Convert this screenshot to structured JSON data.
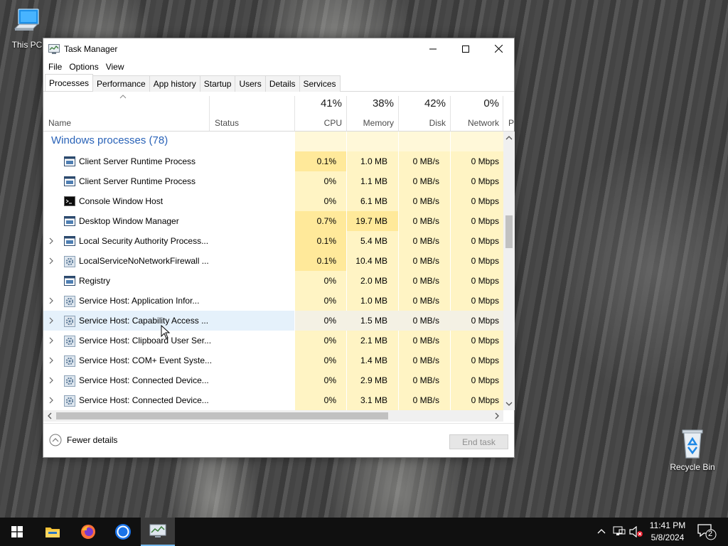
{
  "desktop": {
    "icons": [
      {
        "label": "This PC"
      },
      {
        "label": "Recycle Bin"
      }
    ]
  },
  "window": {
    "title": "Task Manager",
    "menu": [
      "File",
      "Options",
      "View"
    ],
    "tabs": [
      "Processes",
      "Performance",
      "App history",
      "Startup",
      "Users",
      "Details",
      "Services"
    ],
    "active_tab": "Processes",
    "columns": {
      "name": "Name",
      "status": "Status",
      "cpu": {
        "pct": "41%",
        "label": "CPU"
      },
      "memory": {
        "pct": "38%",
        "label": "Memory"
      },
      "disk": {
        "pct": "42%",
        "label": "Disk"
      },
      "network": {
        "pct": "0%",
        "label": "Network"
      },
      "power_partial": "P"
    },
    "group": {
      "title": "Windows processes (78)"
    },
    "processes": [
      {
        "name": "Client Server Runtime Process",
        "cpu": "0.1%",
        "memory": "1.0 MB",
        "disk": "0 MB/s",
        "network": "0 Mbps",
        "expandable": false,
        "icon": "window-icon"
      },
      {
        "name": "Client Server Runtime Process",
        "cpu": "0%",
        "memory": "1.1 MB",
        "disk": "0 MB/s",
        "network": "0 Mbps",
        "expandable": false,
        "icon": "window-icon"
      },
      {
        "name": "Console Window Host",
        "cpu": "0%",
        "memory": "6.1 MB",
        "disk": "0 MB/s",
        "network": "0 Mbps",
        "expandable": false,
        "icon": "console-icon"
      },
      {
        "name": "Desktop Window Manager",
        "cpu": "0.7%",
        "memory": "19.7 MB",
        "disk": "0 MB/s",
        "network": "0 Mbps",
        "expandable": false,
        "icon": "window-icon"
      },
      {
        "name": "Local Security Authority Process...",
        "cpu": "0.1%",
        "memory": "5.4 MB",
        "disk": "0 MB/s",
        "network": "0 Mbps",
        "expandable": true,
        "icon": "window-icon"
      },
      {
        "name": "LocalServiceNoNetworkFirewall ...",
        "cpu": "0.1%",
        "memory": "10.4 MB",
        "disk": "0 MB/s",
        "network": "0 Mbps",
        "expandable": true,
        "icon": "gear-icon"
      },
      {
        "name": "Registry",
        "cpu": "0%",
        "memory": "2.0 MB",
        "disk": "0 MB/s",
        "network": "0 Mbps",
        "expandable": false,
        "icon": "window-icon"
      },
      {
        "name": "Service Host: Application Infor...",
        "cpu": "0%",
        "memory": "1.0 MB",
        "disk": "0 MB/s",
        "network": "0 Mbps",
        "expandable": true,
        "icon": "gear-icon"
      },
      {
        "name": "Service Host: Capability Access ...",
        "cpu": "0%",
        "memory": "1.5 MB",
        "disk": "0 MB/s",
        "network": "0 Mbps",
        "expandable": true,
        "icon": "gear-icon"
      },
      {
        "name": "Service Host: Clipboard User Ser...",
        "cpu": "0%",
        "memory": "2.1 MB",
        "disk": "0 MB/s",
        "network": "0 Mbps",
        "expandable": true,
        "icon": "gear-icon"
      },
      {
        "name": "Service Host: COM+ Event Syste...",
        "cpu": "0%",
        "memory": "1.4 MB",
        "disk": "0 MB/s",
        "network": "0 Mbps",
        "expandable": true,
        "icon": "gear-icon"
      },
      {
        "name": "Service Host: Connected Device...",
        "cpu": "0%",
        "memory": "2.9 MB",
        "disk": "0 MB/s",
        "network": "0 Mbps",
        "expandable": true,
        "icon": "gear-icon"
      },
      {
        "name": "Service Host: Connected Device...",
        "cpu": "0%",
        "memory": "3.1 MB",
        "disk": "0 MB/s",
        "network": "0 Mbps",
        "expandable": true,
        "icon": "gear-icon"
      }
    ],
    "footer": {
      "fewer_details": "Fewer details",
      "end_task": "End task"
    }
  },
  "taskbar": {
    "clock_time": "11:41 PM",
    "clock_date": "5/8/2024",
    "notification_count": "2",
    "active_app": "Task Manager"
  },
  "colors": {
    "heat_light": "#fff4c4",
    "heat_mid": "#ffe99a",
    "heat_header": "#fff8d9",
    "group_title": "#2a63b8",
    "hover_row": "#e5f1fb"
  }
}
